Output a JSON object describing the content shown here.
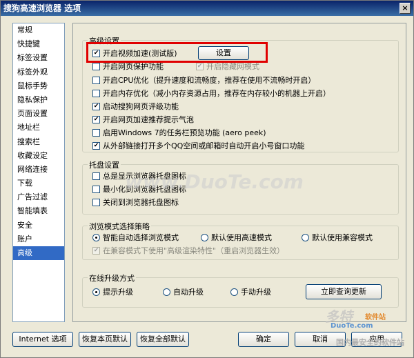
{
  "window": {
    "title": "搜狗高速浏览器 选项",
    "close_label": "×"
  },
  "sidebar": {
    "items": [
      {
        "label": "常规"
      },
      {
        "label": "快捷键"
      },
      {
        "label": "标签设置"
      },
      {
        "label": "标签外观"
      },
      {
        "label": "鼠标手势"
      },
      {
        "label": "隐私保护"
      },
      {
        "label": "页面设置"
      },
      {
        "label": "地址栏"
      },
      {
        "label": "搜索栏"
      },
      {
        "label": "收藏设定"
      },
      {
        "label": "网络连接"
      },
      {
        "label": "下载"
      },
      {
        "label": "广告过滤"
      },
      {
        "label": "智能填表"
      },
      {
        "label": "安全"
      },
      {
        "label": "账户"
      },
      {
        "label": "高级",
        "selected": true
      }
    ]
  },
  "advanced": {
    "legend": "高级设置",
    "video_accel": {
      "label": "开启视频加速(测试版)",
      "checked": true
    },
    "settings_button": "设置",
    "page_protect": {
      "label": "开启网页保护功能",
      "checked": false
    },
    "hidden_mode": {
      "label": "开启隐藏网模式",
      "checked": true,
      "disabled": true
    },
    "cpu_opt": {
      "label": "开启CPU优化（提升速度和流畅度，推荐在使用不流畅时开启）",
      "checked": false
    },
    "mem_opt": {
      "label": "开启内存优化（减小内存资源占用，推荐在内存较小的机器上开启）",
      "checked": false
    },
    "rating": {
      "label": "启动搜狗网页评级功能",
      "checked": true
    },
    "accel_bubble": {
      "label": "开启网页加速推荐提示气泡",
      "checked": true
    },
    "win7_preview": {
      "label": "启用Windows 7的任务栏预览功能 (aero peek)",
      "checked": false
    },
    "qq_links": {
      "label": "从外部链接打开多个QQ空间或邮箱时自动开启小号窗口功能",
      "checked": true
    }
  },
  "tray": {
    "legend": "托盘设置",
    "always_show": {
      "label": "总是显示浏览器托盘图标",
      "checked": false
    },
    "minimize_tray": {
      "label": "最小化到浏览器托盘图标",
      "checked": false
    },
    "close_tray": {
      "label": "关闭到浏览器托盘图标",
      "checked": false
    }
  },
  "browse_mode": {
    "legend": "浏览模式选择策略",
    "options": [
      {
        "label": "智能自动选择浏览模式",
        "checked": true
      },
      {
        "label": "默认使用高速模式",
        "checked": false
      },
      {
        "label": "默认使用兼容模式",
        "checked": false
      }
    ],
    "compat_render": {
      "label": "在兼容模式下使用\"高级渲染特性\"（重启浏览器生效）",
      "checked": true,
      "disabled": true
    }
  },
  "upgrade": {
    "legend": "在线升级方式",
    "options": [
      {
        "label": "提示升级",
        "checked": true
      },
      {
        "label": "自动升级",
        "checked": false
      },
      {
        "label": "手动升级",
        "checked": false
      }
    ],
    "check_now": "立即查询更新"
  },
  "footer": {
    "internet_options": "Internet 选项",
    "restore_page": "恢复本页默认",
    "restore_all": "恢复全部默认",
    "ok": "确定",
    "cancel": "取消",
    "apply": "应用"
  },
  "watermarks": {
    "center": "www.DuoTe.com",
    "logo": "多特",
    "logo_sub": "软件站",
    "logo_url": "DuoTe.com",
    "bottom": "国内最安全的软件站"
  },
  "colors": {
    "selected": "#316ac5",
    "highlight": "#e00000",
    "title_bar": "#0a246a"
  }
}
